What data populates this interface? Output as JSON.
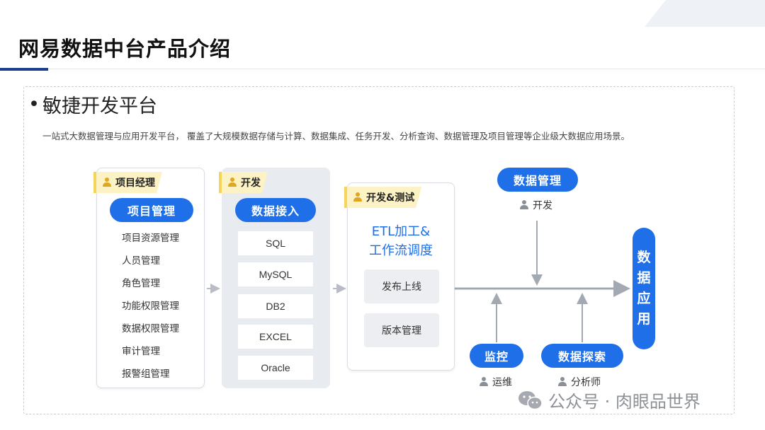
{
  "page": {
    "title": "网易数据中台产品介绍",
    "section_title": "敏捷开发平台",
    "bullet": "•",
    "description": "一站式大数据管理与应用开发平台， 覆盖了大规模数据存储与计算、数据集成、任务开发、分析查询、数据管理及项目管理等企业级大数据应用场景。"
  },
  "colors": {
    "accent_blue": "#1e6fe8",
    "title_bar": "#1a3f8c",
    "tag_yellow": "#fdf2c4",
    "panel_gray": "#e8ebef"
  },
  "project_panel": {
    "role": "项目经理",
    "header": "项目管理",
    "items": [
      "项目资源管理",
      "人员管理",
      "角色管理",
      "功能权限管理",
      "数据权限管理",
      "审计管理",
      "报警组管理"
    ]
  },
  "ingest_panel": {
    "role": "开发",
    "header": "数据接入",
    "sources": [
      "SQL",
      "MySQL",
      "DB2",
      "EXCEL",
      "Oracle"
    ]
  },
  "etl_panel": {
    "role": "开发&测试",
    "title_line1": "ETL加工&",
    "title_line2": "工作流调度",
    "steps": [
      "发布上线",
      "版本管理"
    ]
  },
  "data_management": {
    "label": "数据管理",
    "role": "开发"
  },
  "monitoring": {
    "label": "监控",
    "role": "运维"
  },
  "data_exploration": {
    "label": "数据探索",
    "role": "分析师"
  },
  "data_application": {
    "chars": [
      "数",
      "据",
      "应",
      "用"
    ]
  },
  "watermark": {
    "text": "公众号 · 肉眼品世界",
    "icon": "wechat-icon"
  }
}
